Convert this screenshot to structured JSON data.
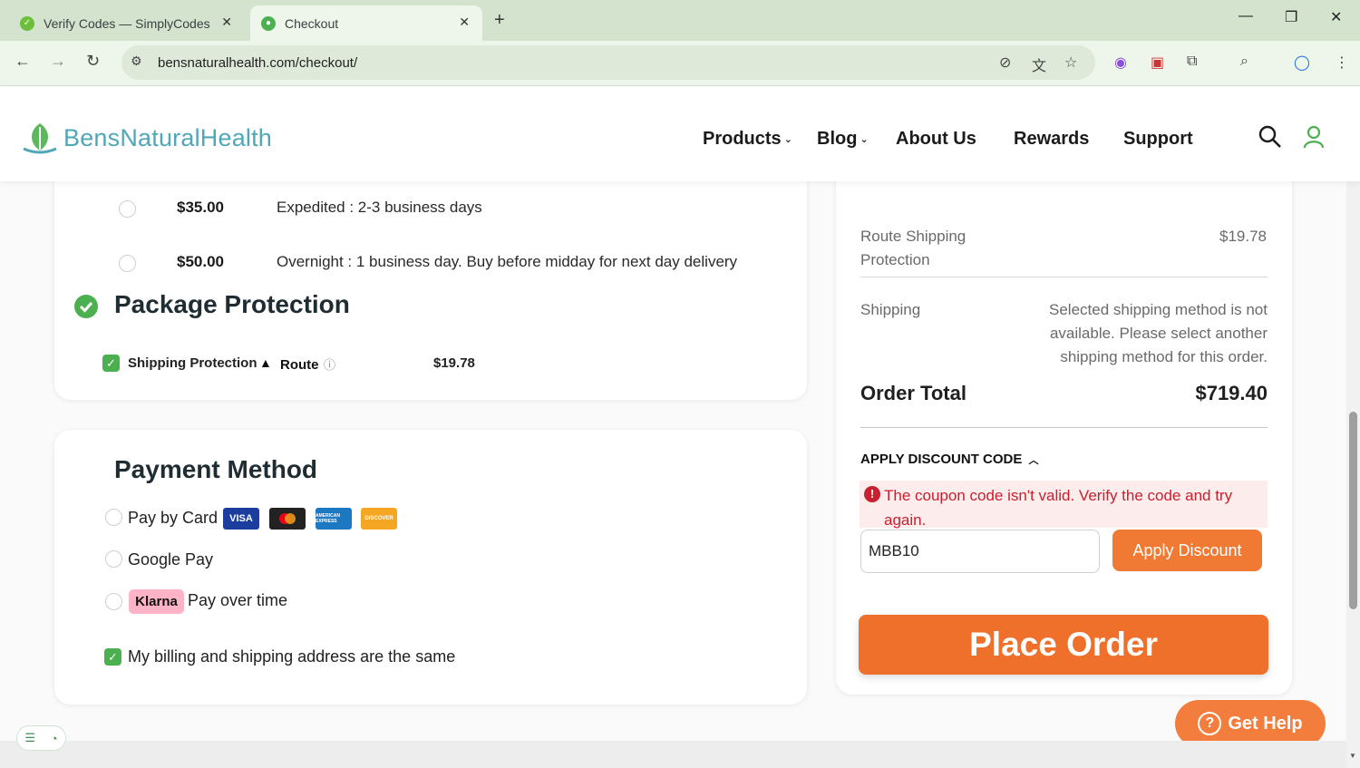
{
  "browser": {
    "tabs": [
      {
        "title": "Verify Codes — SimplyCodes",
        "active": false
      },
      {
        "title": "Checkout",
        "active": true
      }
    ],
    "url": "bensnaturalhealth.com/checkout/"
  },
  "header": {
    "brand": "BensNaturalHealth",
    "nav": [
      "Products",
      "Blog",
      "About Us",
      "Rewards",
      "Support"
    ]
  },
  "shipping_options": [
    {
      "price": "$35.00",
      "description": "Expedited : 2-3 business days"
    },
    {
      "price": "$50.00",
      "description": "Overnight : 1 business day. Buy before midday for next day delivery"
    }
  ],
  "package_protection": {
    "title": "Package Protection",
    "item_label": "Shipping Protection",
    "provider": "Route",
    "price": "$19.78",
    "checked": true
  },
  "payment": {
    "title": "Payment Method",
    "options": [
      {
        "label": "Pay by Card"
      },
      {
        "label": "Google Pay"
      },
      {
        "label": "Pay over time",
        "badge": "Klarna"
      }
    ],
    "card_brands": [
      "VISA",
      "mastercard",
      "AMERICAN EXPRESS",
      "DISCOVER"
    ],
    "billing_same_label": "My billing and shipping address are the same",
    "billing_same_checked": true
  },
  "summary": {
    "route_label": "Route Shipping Protection",
    "route_value": "$19.78",
    "shipping_label": "Shipping",
    "shipping_value": "Selected shipping method is not available. Please select another shipping method for this order.",
    "total_label": "Order Total",
    "total_value": "$719.40",
    "discount_heading": "APPLY DISCOUNT CODE",
    "error_message": "The coupon code isn't valid. Verify the code and try again.",
    "coupon_value": "MBB10",
    "apply_label": "Apply Discount",
    "place_order_label": "Place Order"
  },
  "help_label": "Get Help",
  "colors": {
    "accent_orange": "#ef702a",
    "check_green": "#4caf50",
    "brand_teal": "#4fa7b8",
    "error_red": "#c8202f"
  }
}
